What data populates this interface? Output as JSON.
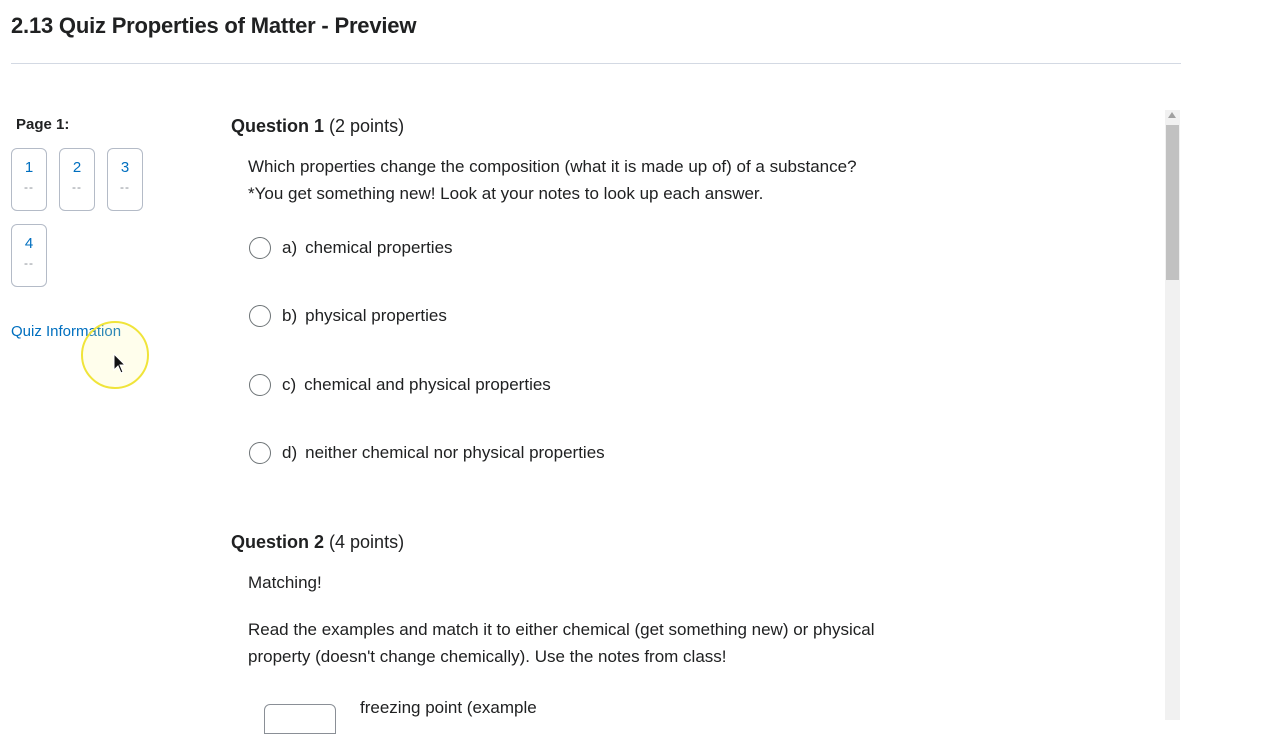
{
  "header": {
    "title": "2.13 Quiz Properties of Matter - Preview"
  },
  "sidebar": {
    "page_label": "Page 1:",
    "questions": [
      {
        "num": "1",
        "status": "--"
      },
      {
        "num": "2",
        "status": "--"
      },
      {
        "num": "3",
        "status": "--"
      },
      {
        "num": "4",
        "status": "--"
      }
    ],
    "quiz_info_link": "Quiz Information"
  },
  "questions": [
    {
      "title": "Question 1",
      "points": "(2 points)",
      "text_line1": "Which properties change the composition (what it is made up of) of a substance?",
      "text_line2": "*You get something new! Look at your notes to look up each answer.",
      "choices": [
        {
          "letter": "a)",
          "text": "chemical properties"
        },
        {
          "letter": "b)",
          "text": "physical properties"
        },
        {
          "letter": "c)",
          "text": "chemical and physical properties"
        },
        {
          "letter": "d)",
          "text": "neither chemical nor physical properties"
        }
      ]
    },
    {
      "title": "Question 2",
      "points": "(4 points)",
      "intro": "Matching!",
      "text_line1": "Read the examples and match it to either chemical (get something new) or physical",
      "text_line2": "property (doesn't change chemically).  Use the notes from class!",
      "items": [
        {
          "text": "freezing point (example"
        }
      ]
    }
  ]
}
